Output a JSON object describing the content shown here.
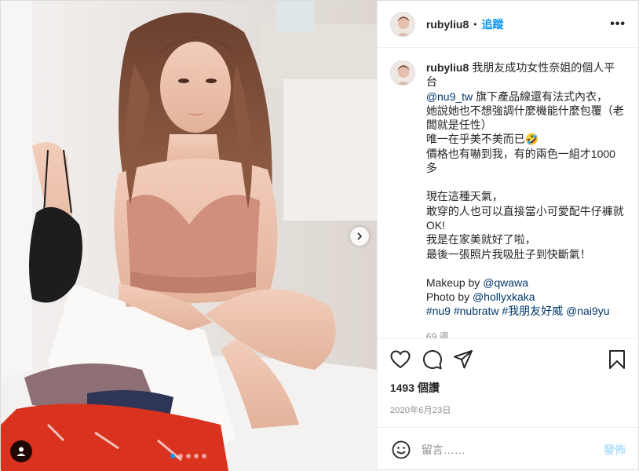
{
  "header": {
    "username": "rubyliu8",
    "separator": "•",
    "follow_label": "追蹤",
    "more_label": "•••"
  },
  "caption": {
    "username": "rubyliu8",
    "line1": "我朋友成功女性奈姐的個人平台",
    "mention_nu9": "@nu9_tw",
    "line2": "旗下產品線還有法式內衣，",
    "line3": "她說她也不想強調什麼機能什麼包覆（老闆就是任性）",
    "line4": "唯一在乎美不美而已",
    "line4_emoji": "🤣",
    "line5": "價格也有嚇到我，有的兩色一組才1000多",
    "line6": "現在這種天氣，",
    "line7": "敢穿的人也可以直接當小可愛配牛仔褲就OK!",
    "line8": "我是在家美就好了啦，",
    "line9": "最後一張照片我吸肚子到快斷氣！",
    "makeup_prefix": "Makeup by",
    "makeup_mention": "@qwawa",
    "photo_prefix": "Photo by",
    "photo_mention": "@hollyxkaka",
    "tags": [
      "#nu9",
      "#nubratw",
      "#我朋友好威",
      "@nai9yu"
    ],
    "time_ago": "69 週"
  },
  "actions": {
    "like_icon": "heart-icon",
    "comment_icon": "comment-icon",
    "share_icon": "paper-plane-icon",
    "save_icon": "bookmark-icon"
  },
  "stats": {
    "views": "1493 個讚",
    "date": "2020年6月23日"
  },
  "comment_box": {
    "placeholder": "留言……",
    "post_label": "發佈"
  },
  "carousel": {
    "slide_count": 5,
    "active_index": 0
  },
  "colors": {
    "accent": "#0095f6",
    "link": "#00376b",
    "muted": "#8e8e8e",
    "post_disabled": "#b2dffc"
  }
}
